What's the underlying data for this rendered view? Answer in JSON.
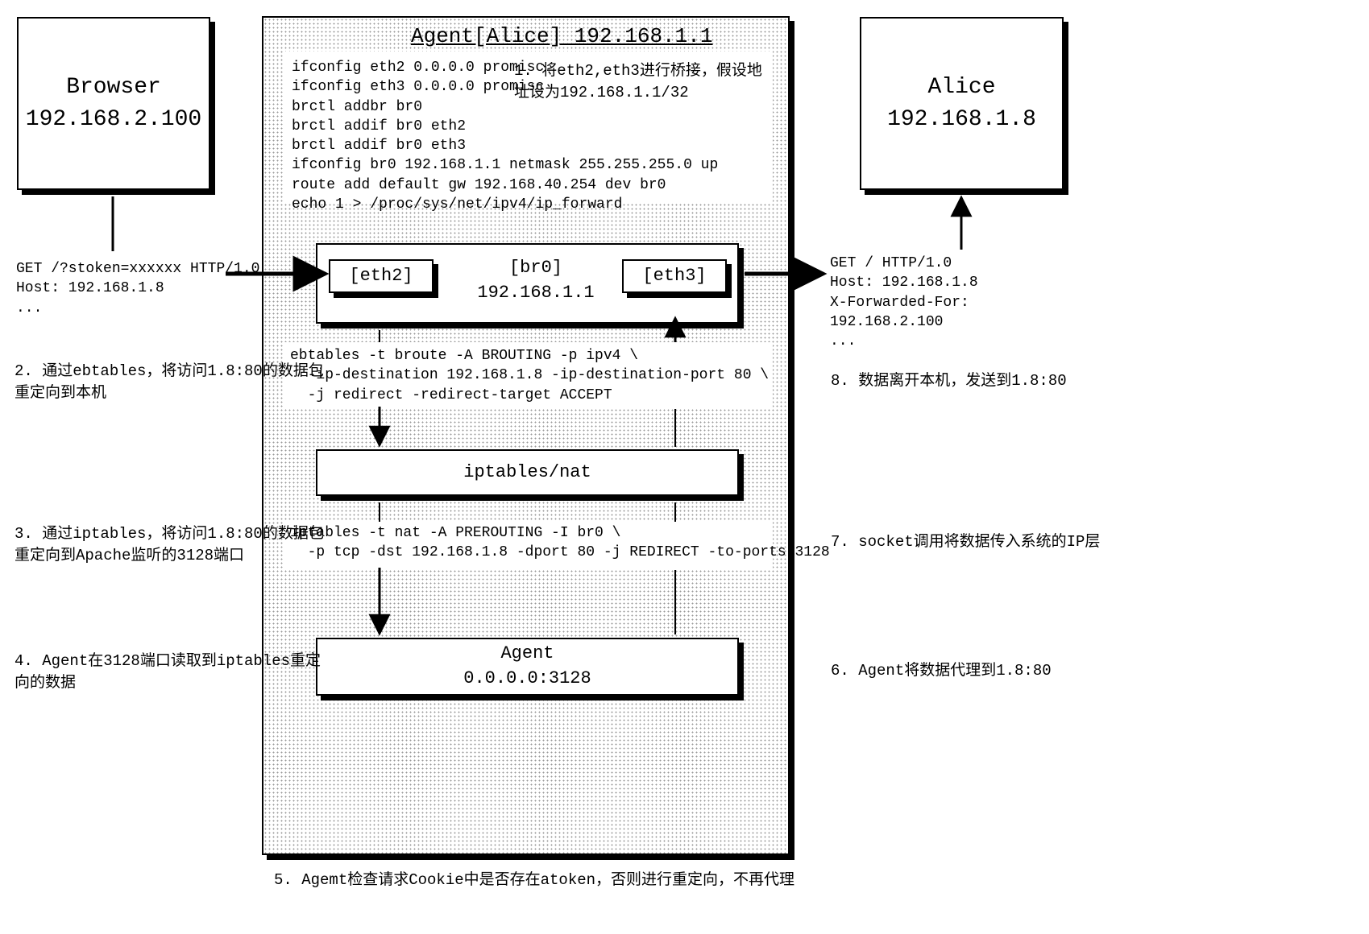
{
  "browser": {
    "title": "Browser",
    "ip": "192.168.2.100"
  },
  "alice": {
    "title": "Alice",
    "ip": "192.168.1.8"
  },
  "agent": {
    "title": "Agent[Alice] 192.168.1.1",
    "config": "ifconfig eth2 0.0.0.0 promisc\nifconfig eth3 0.0.0.0 promisc\nbrctl addbr br0\nbrctl addif br0 eth2\nbrctl addif br0 eth3\nifconfig br0 192.168.1.1 netmask 255.255.255.0 up\nroute add default gw 192.168.40.254 dev br0\necho 1 > /proc/sys/net/ipv4/ip_forward",
    "step1": "1. 将eth2,eth3进行桥接，假设地\n址设为192.168.1.1/32",
    "eth2": "[eth2]",
    "eth3": "[eth3]",
    "br0_line1": "[br0]",
    "br0_line2": "192.168.1.1",
    "ebtables": "ebtables -t broute -A BROUTING -p ipv4 \\\n  -ip-destination 192.168.1.8 -ip-destination-port 80 \\\n  -j redirect -redirect-target ACCEPT",
    "iptables_box": "iptables/nat",
    "iptables_cmd": "iptables -t nat -A PREROUTING -I br0 \\\n  -p tcp -dst 192.168.1.8 -dport 80 -j REDIRECT -to-ports 3128",
    "agent_box_line1": "Agent",
    "agent_box_line2": "0.0.0.0:3128"
  },
  "left": {
    "get": "GET /?stoken=xxxxxx HTTP/1.0\nHost: 192.168.1.8\n...",
    "step2": "2. 通过ebtables，将访问1.8:80的数据包\n重定向到本机",
    "step3": "3. 通过iptables，将访问1.8:80的数据包\n重定向到Apache监听的3128端口",
    "step4": "4. Agent在3128端口读取到iptables重定\n向的数据"
  },
  "right": {
    "get": "GET / HTTP/1.0\nHost: 192.168.1.8\nX-Forwarded-For:\n192.168.2.100\n...",
    "step6": "6. Agent将数据代理到1.8:80",
    "step7": "7. socket调用将数据传入系统的IP层",
    "step8": "8. 数据离开本机，发送到1.8:80"
  },
  "bottom": {
    "step5": "5. Agemt检查请求Cookie中是否存在atoken，否则进行重定向，不再代理"
  }
}
